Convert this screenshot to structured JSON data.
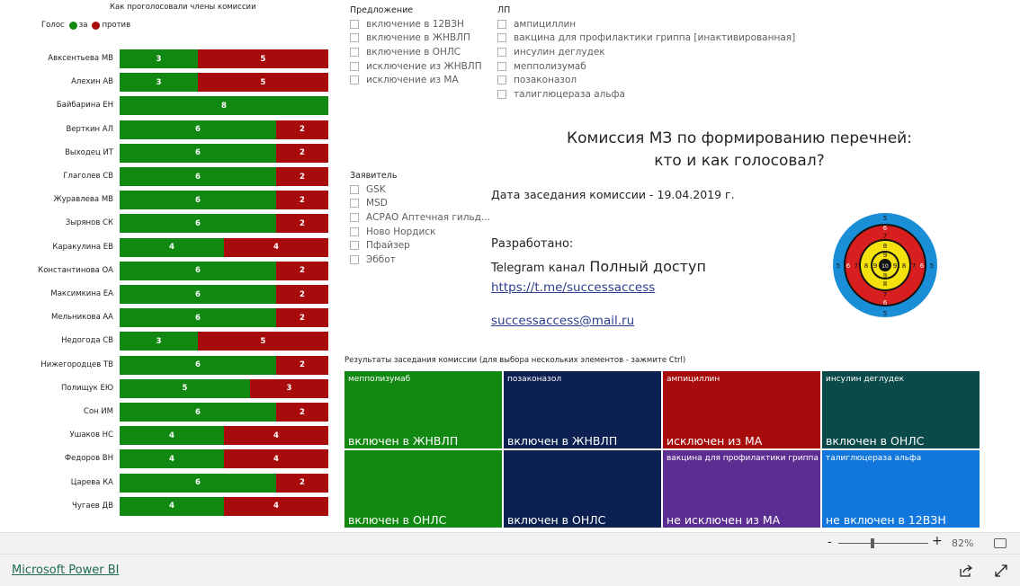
{
  "chart": {
    "title": "Как проголосовали члены комиссии",
    "legend_label": "Голос",
    "legend_yes": "за",
    "legend_no": "против",
    "colors": {
      "yes": "#118811",
      "no": "#a80b0b"
    }
  },
  "chart_data": {
    "type": "bar",
    "stacked": true,
    "orientation": "horizontal",
    "title": "Как проголосовали члены комиссии",
    "legend_title": "Голос",
    "categories": [
      "Авксентьева МВ",
      "Алехин АВ",
      "Байбарина ЕН",
      "Верткин АЛ",
      "Выходец ИТ",
      "Глаголев СВ",
      "Журавлева МВ",
      "Зырянов СК",
      "Каракулина ЕВ",
      "Константинова ОА",
      "Максимкина ЕА",
      "Мельникова АА",
      "Недогода СВ",
      "Нижегородцев ТВ",
      "Полищук ЕЮ",
      "Сон ИМ",
      "Ушаков НС",
      "Федоров ВН",
      "Царева КА",
      "Чугаев ДВ"
    ],
    "series": [
      {
        "name": "за",
        "color": "#118811",
        "values": [
          3,
          3,
          8,
          6,
          6,
          6,
          6,
          6,
          4,
          6,
          6,
          6,
          3,
          6,
          5,
          6,
          4,
          4,
          6,
          4
        ]
      },
      {
        "name": "против",
        "color": "#a80b0b",
        "values": [
          5,
          5,
          0,
          2,
          2,
          2,
          2,
          2,
          4,
          2,
          2,
          2,
          5,
          2,
          3,
          2,
          4,
          4,
          2,
          4
        ]
      }
    ],
    "xlim": [
      0,
      8
    ],
    "legend_position": "top-left"
  },
  "slicers": {
    "proposal": {
      "title": "Предложение",
      "items": [
        "включение в 12ВЗН",
        "включение в ЖНВЛП",
        "включение в ОНЛС",
        "исключение из ЖНВЛП",
        "исключение из МА"
      ]
    },
    "drug": {
      "title": "ЛП",
      "items": [
        "ампициллин",
        "вакцина для профилактики гриппа [инактивированная]",
        "инсулин деглудек",
        "мепполизумаб",
        "позаконазол",
        "талиглюцераза альфа"
      ]
    },
    "applicant": {
      "title": "Заявитель",
      "items": [
        "GSK",
        "MSD",
        "АСРАО Аптечная гильд...",
        "Ново Нордиск",
        "Пфайзер",
        "Эббот"
      ]
    }
  },
  "info": {
    "title_line1": "Комиссия МЗ по формированию перечней:",
    "title_line2": "кто и как голосовал?",
    "meeting_date": "Дата заседания комиссии - 19.04.2019 г.",
    "developed": "Разработано:",
    "telegram_prefix": "Telegram канал",
    "telegram_name": "Полный доступ",
    "telegram_link": "https://t.me/successaccess",
    "email": "successaccess@mail.ru"
  },
  "target": {
    "ring_numbers": [
      "5",
      "6",
      "7",
      "8",
      "9",
      "10"
    ]
  },
  "treemap": {
    "title": "Результаты заседания комиссии (для выбора нескольких элементов - зажмите Ctrl)",
    "columns": [
      {
        "drug": "мепполизумаб",
        "color": "#118811",
        "top": "включен в ЖНВЛП",
        "bottom": "включен в ОНЛС",
        "bottom_drug": "",
        "bottom_color": "#118811"
      },
      {
        "drug": "позаконазол",
        "color": "#0c2152",
        "top": "включен в ЖНВЛП",
        "bottom": "включен в ОНЛС",
        "bottom_drug": "",
        "bottom_color": "#0c2152"
      },
      {
        "drug": "ампициллин",
        "color": "#a80b0b",
        "top": "исключен из МА",
        "bottom": "не исключен из МА",
        "bottom_drug": "вакцина для профилактики гриппа ...",
        "bottom_color": "#5d2e91"
      },
      {
        "drug": "инсулин деглудек",
        "color": "#0b4a4a",
        "top": "включен в ОНЛС",
        "bottom": "не включен в 12ВЗН",
        "bottom_drug": "талиглюцераза альфа",
        "bottom_color": "#1177dd"
      }
    ]
  },
  "footer": {
    "zoom_minus": "-",
    "zoom_plus": "+",
    "zoom_level": "82%",
    "powerbi_link": "Microsoft Power BI"
  }
}
